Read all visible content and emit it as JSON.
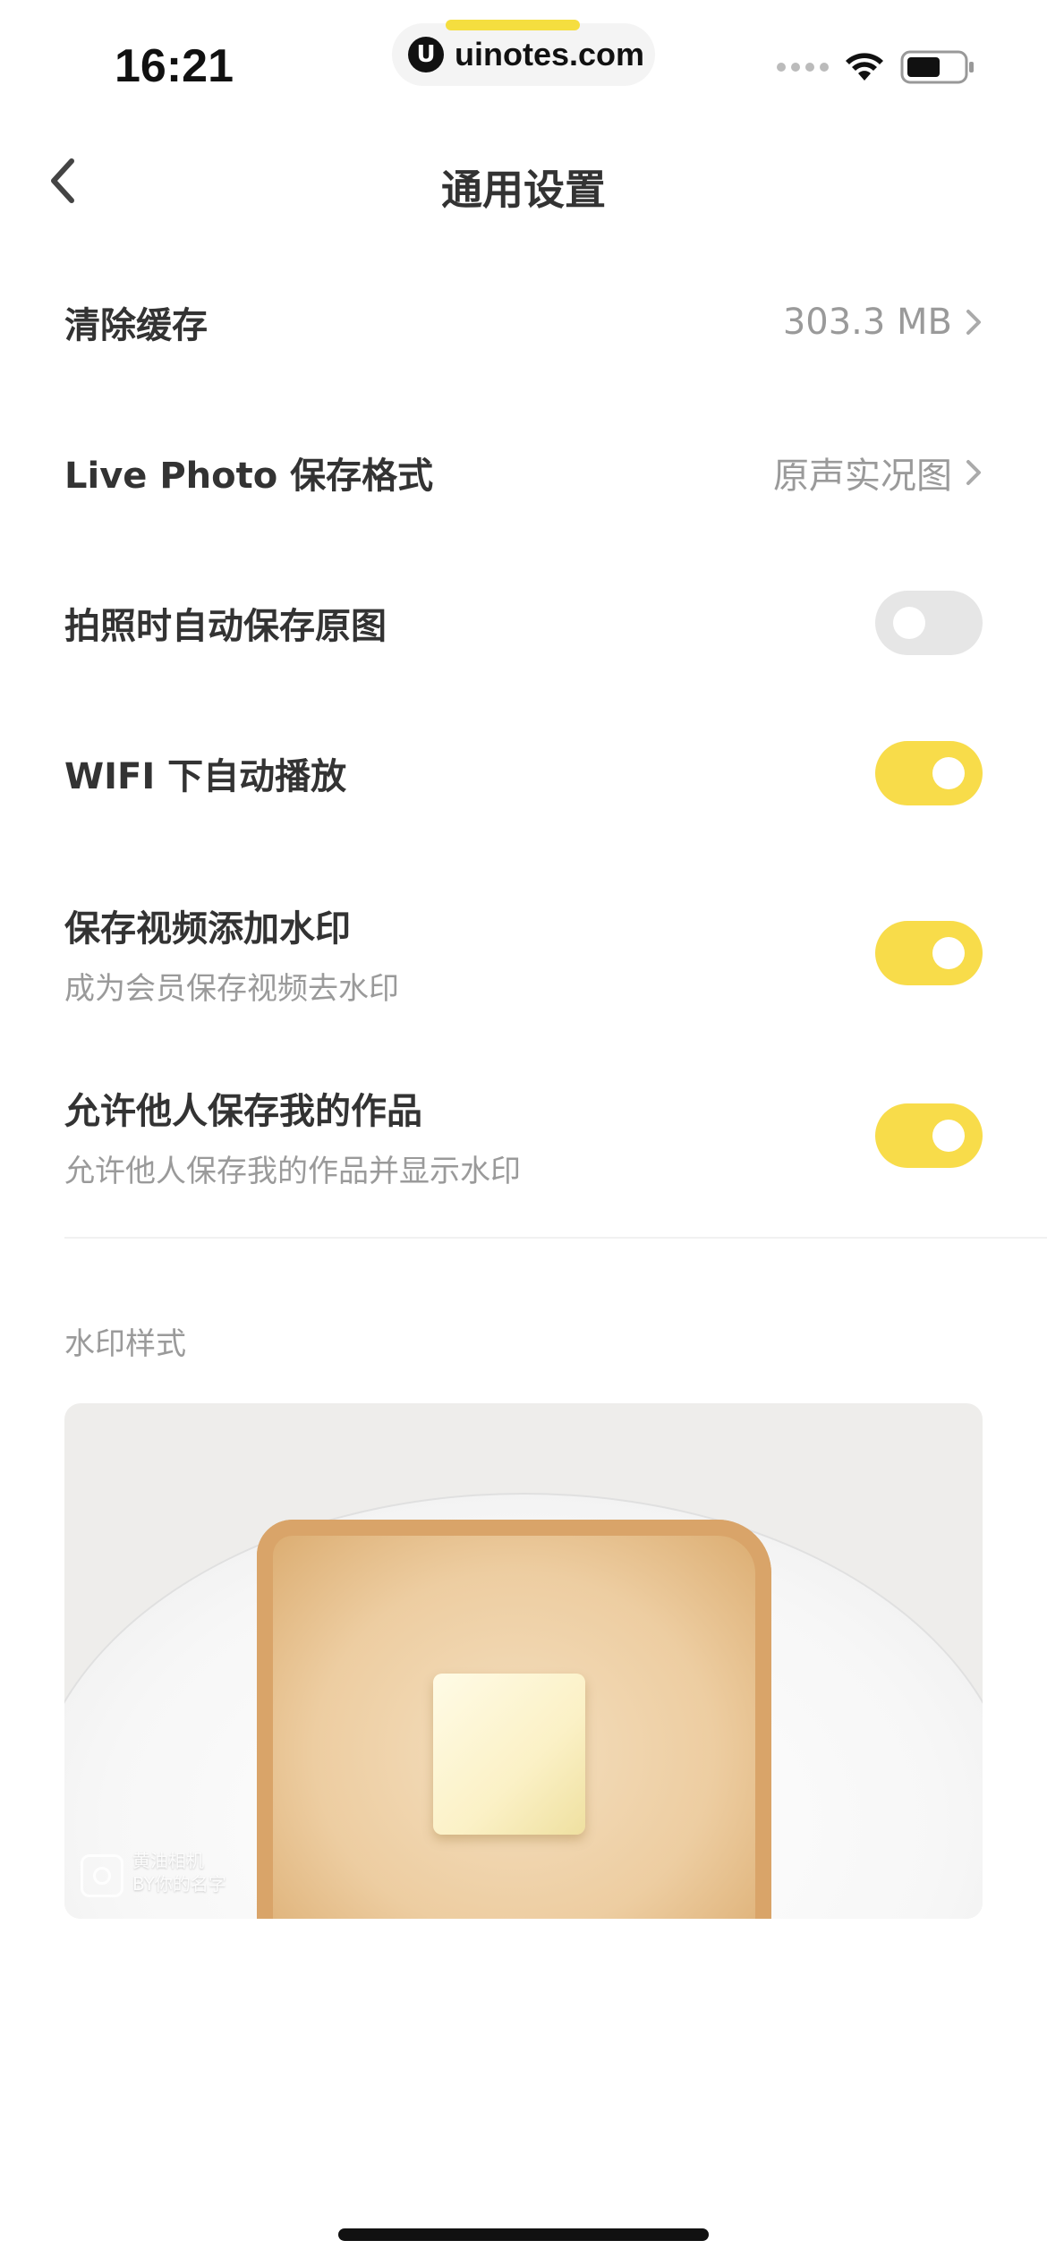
{
  "status_bar": {
    "time": "16:21",
    "url": "uinotes.com",
    "url_logo": "U",
    "icons": [
      "signal-icon",
      "wifi-icon",
      "battery-icon"
    ]
  },
  "nav": {
    "title": "通用设置",
    "back_icon": "chevron-left-icon"
  },
  "settings": {
    "clear_cache": {
      "label": "清除缓存",
      "value": "303.3 MB"
    },
    "live_photo": {
      "label": "Live Photo 保存格式",
      "value": "原声实况图"
    },
    "auto_save_original": {
      "label": "拍照时自动保存原图",
      "enabled": false
    },
    "wifi_autoplay": {
      "label": "WIFI 下自动播放",
      "enabled": true
    },
    "video_watermark": {
      "label": "保存视频添加水印",
      "sublabel": "成为会员保存视频去水印",
      "enabled": true
    },
    "allow_save": {
      "label": "允许他人保存我的作品",
      "sublabel": "允许他人保存我的作品并显示水印",
      "enabled": true
    }
  },
  "watermark": {
    "section_label": "水印样式",
    "brand": "黄油相机",
    "byline": "BY你的名字"
  },
  "colors": {
    "accent": "#f8dc4a",
    "toggle_off": "#e6e6e6",
    "text_primary": "#333333",
    "text_secondary": "#9a9a9a"
  }
}
